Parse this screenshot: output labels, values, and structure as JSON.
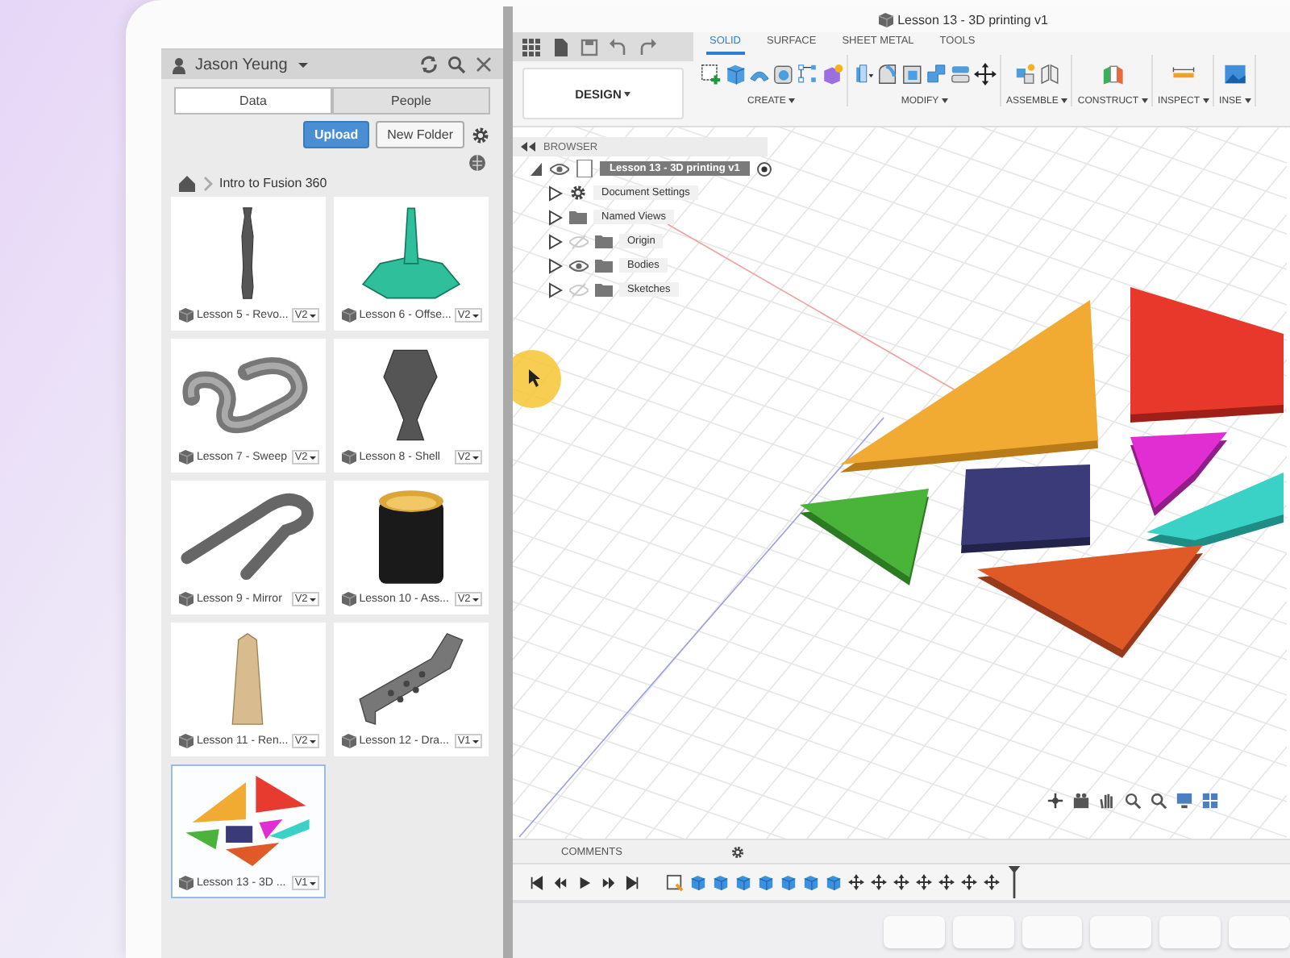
{
  "document_title": "Lesson 13 - 3D printing v1",
  "data_panel": {
    "user": "Jason Yeung",
    "tabs": [
      {
        "label": "Data",
        "selected": true
      },
      {
        "label": "People",
        "selected": false
      }
    ],
    "buttons": [
      {
        "label": "Upload",
        "kind": "primary"
      },
      {
        "label": "New Folder",
        "kind": "secondary"
      }
    ],
    "breadcrumb": "Intro to Fusion 360",
    "items": [
      {
        "name": "Lesson 5 - Revo...",
        "version": "V2",
        "kind": "rod",
        "selected": false
      },
      {
        "name": "Lesson 6 - Offse...",
        "version": "V2",
        "kind": "cone",
        "selected": false
      },
      {
        "name": "Lesson 7 - Sweep",
        "version": "V2",
        "kind": "pipe",
        "selected": false
      },
      {
        "name": "Lesson 8 - Shell",
        "version": "V2",
        "kind": "vase",
        "selected": false
      },
      {
        "name": "Lesson 9 - Mirror",
        "version": "V2",
        "kind": "clip",
        "selected": false
      },
      {
        "name": "Lesson 10 - Ass...",
        "version": "V2",
        "kind": "cup",
        "selected": false
      },
      {
        "name": "Lesson 11 - Ren...",
        "version": "V2",
        "kind": "obelisk",
        "selected": false
      },
      {
        "name": "Lesson 12 - Dra...",
        "version": "V1",
        "kind": "bracket",
        "selected": false
      },
      {
        "name": "Lesson 13 - 3D ...",
        "version": "V1",
        "kind": "tangram",
        "selected": true
      }
    ]
  },
  "toolbar": {
    "workspace": "DESIGN",
    "tabs": [
      {
        "label": "SOLID",
        "selected": true
      },
      {
        "label": "SURFACE",
        "selected": false
      },
      {
        "label": "SHEET METAL",
        "selected": false
      },
      {
        "label": "TOOLS",
        "selected": false
      }
    ],
    "groups": [
      "CREATE",
      "MODIFY",
      "ASSEMBLE",
      "CONSTRUCT",
      "INSPECT",
      "INSE"
    ]
  },
  "browser": {
    "title": "BROWSER",
    "root": "Lesson 13 - 3D printing v1",
    "nodes": [
      {
        "label": "Document Settings",
        "kind": "settings"
      },
      {
        "label": "Named Views",
        "kind": "folder"
      },
      {
        "label": "Origin",
        "kind": "folder",
        "visible": false
      },
      {
        "label": "Bodies",
        "kind": "folder",
        "visible": true
      },
      {
        "label": "Sketches",
        "kind": "folder",
        "visible": false
      }
    ]
  },
  "comments": {
    "title": "COMMENTS"
  }
}
